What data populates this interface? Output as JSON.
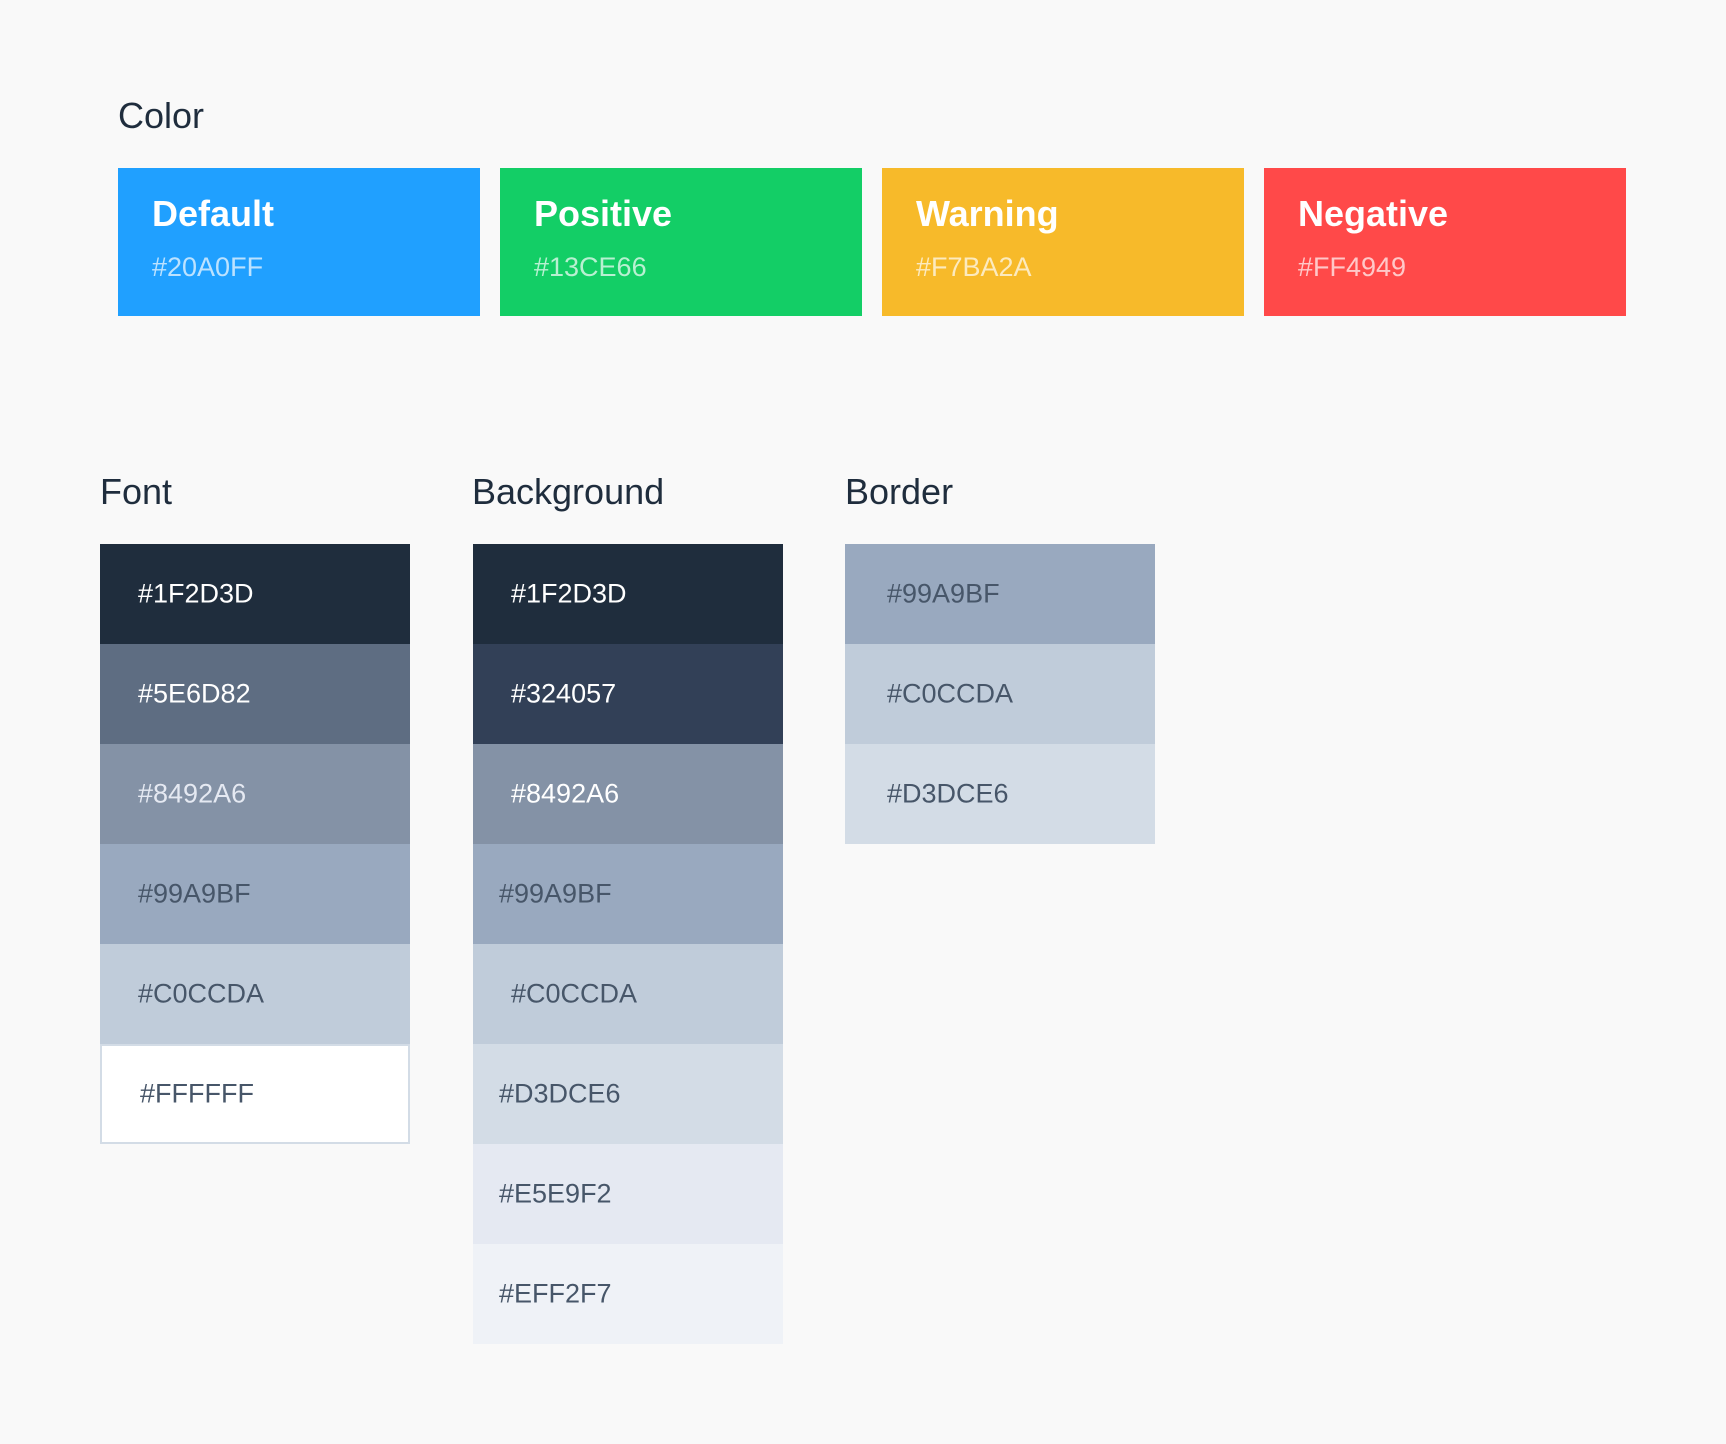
{
  "color": {
    "heading": "Color",
    "cards": [
      {
        "name": "Default",
        "hex": "#20A0FF",
        "color": "#20A0FF"
      },
      {
        "name": "Positive",
        "hex": "#13CE66",
        "color": "#13CE66"
      },
      {
        "name": "Warning",
        "hex": "#F7BA2A",
        "color": "#F7BA2A"
      },
      {
        "name": "Negative",
        "hex": "#FF4949",
        "color": "#FF4949"
      }
    ]
  },
  "font": {
    "heading": "Font",
    "swatches": [
      {
        "hex": "#1F2D3D",
        "color": "#1F2D3D",
        "text_color": "#FFFFFF"
      },
      {
        "hex": "#5E6D82",
        "color": "#5E6D82",
        "text_color": "#FFFFFF"
      },
      {
        "hex": "#8492A6",
        "color": "#8492A6",
        "text_color": "#E5E9F2"
      },
      {
        "hex": "#99A9BF",
        "color": "#99A9BF",
        "text_color": "#475669"
      },
      {
        "hex": "#C0CCDA",
        "color": "#C0CCDA",
        "text_color": "#475669"
      },
      {
        "hex": "#FFFFFF",
        "color": "#FFFFFF",
        "text_color": "#475669"
      }
    ]
  },
  "background": {
    "heading": "Background",
    "swatches": [
      {
        "hex": "#1F2D3D",
        "color": "#1F2D3D",
        "text_color": "#FFFFFF"
      },
      {
        "hex": "#324057",
        "color": "#324057",
        "text_color": "#FFFFFF"
      },
      {
        "hex": "#8492A6",
        "color": "#8492A6",
        "text_color": "#FFFFFF"
      },
      {
        "hex": "#99A9BF",
        "color": "#99A9BF",
        "text_color": "#475669"
      },
      {
        "hex": "#C0CCDA",
        "color": "#C0CCDA",
        "text_color": "#475669"
      },
      {
        "hex": "#D3DCE6",
        "color": "#D3DCE6",
        "text_color": "#475669"
      },
      {
        "hex": "#E5E9F2",
        "color": "#E5E9F2",
        "text_color": "#475669"
      },
      {
        "hex": "#EFF2F7",
        "color": "#EFF2F7",
        "text_color": "#475669"
      }
    ]
  },
  "border": {
    "heading": "Border",
    "swatches": [
      {
        "hex": "#99A9BF",
        "color": "#99A9BF",
        "text_color": "#475669"
      },
      {
        "hex": "#C0CCDA",
        "color": "#C0CCDA",
        "text_color": "#475669"
      },
      {
        "hex": "#D3DCE6",
        "color": "#D3DCE6",
        "text_color": "#475669"
      }
    ]
  }
}
